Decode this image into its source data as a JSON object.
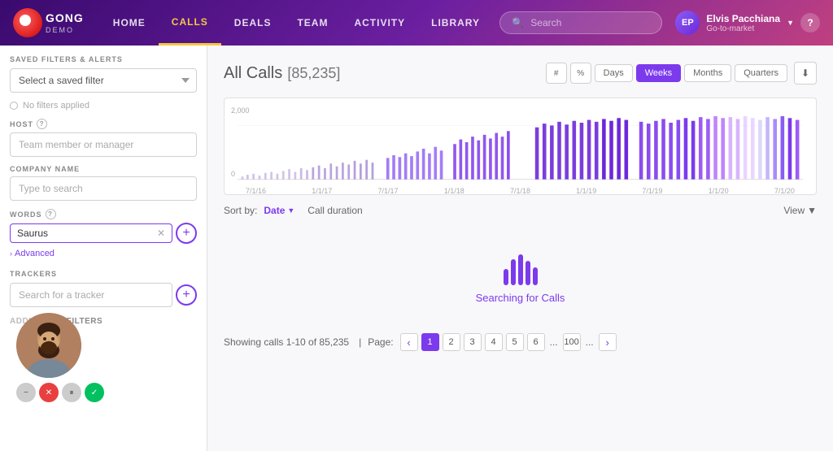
{
  "nav": {
    "logo_text": "GONG",
    "logo_sub": "DEMO",
    "items": [
      {
        "id": "home",
        "label": "HOME",
        "active": false
      },
      {
        "id": "calls",
        "label": "CALLS",
        "active": true
      },
      {
        "id": "deals",
        "label": "DEALS",
        "active": false
      },
      {
        "id": "team",
        "label": "TEAM",
        "active": false
      },
      {
        "id": "activity",
        "label": "ACTIVITY",
        "active": false
      },
      {
        "id": "library",
        "label": "LIBRARY",
        "active": false
      }
    ],
    "search_placeholder": "Search",
    "user_name": "Elvis Pacchiana",
    "user_role": "Go-to-market",
    "help": "?"
  },
  "sidebar": {
    "saved_filters_label": "SAVED FILTERS & ALERTS",
    "saved_filters_placeholder": "Select a saved filter",
    "no_filters_text": "No filters applied",
    "host_label": "HOST",
    "host_placeholder": "Team member or manager",
    "company_label": "COMPANY NAME",
    "company_placeholder": "Type to search",
    "words_label": "WORDS",
    "words_value": "Saurus",
    "advanced_label": "Advanced",
    "trackers_label": "TRACKERS",
    "trackers_placeholder": "Search for a tracker",
    "additional_filters_label": "TIONAL FILTERS"
  },
  "main": {
    "page_title": "All Calls",
    "call_count": "[85,235]",
    "chart_controls": {
      "hash_label": "#",
      "percent_label": "%",
      "periods": [
        "Days",
        "Weeks",
        "Months",
        "Quarters"
      ],
      "active_period": "Weeks"
    },
    "chart": {
      "y_max": "2,000",
      "y_min": "0",
      "x_labels": [
        "7/1/16",
        "1/1/17",
        "7/1/17",
        "1/1/18",
        "7/1/18",
        "1/1/19",
        "7/1/19",
        "1/1/20",
        "7/1/20"
      ]
    },
    "sort": {
      "label": "Sort by:",
      "items": [
        {
          "id": "date",
          "label": "Date",
          "active": true,
          "arrow": "▼"
        },
        {
          "id": "duration",
          "label": "Call duration",
          "active": false
        }
      ],
      "view_label": "View"
    },
    "searching_text": "Searching for Calls",
    "pagination": {
      "info": "Showing calls 1-10 of 85,235",
      "page_label": "Page:",
      "pages": [
        "1",
        "2",
        "3",
        "4",
        "5",
        "6"
      ],
      "ellipsis": "...",
      "last_page": "100"
    }
  },
  "controls": {
    "minus": "−",
    "close": "✕",
    "pause": "⏸",
    "check": "✓"
  }
}
